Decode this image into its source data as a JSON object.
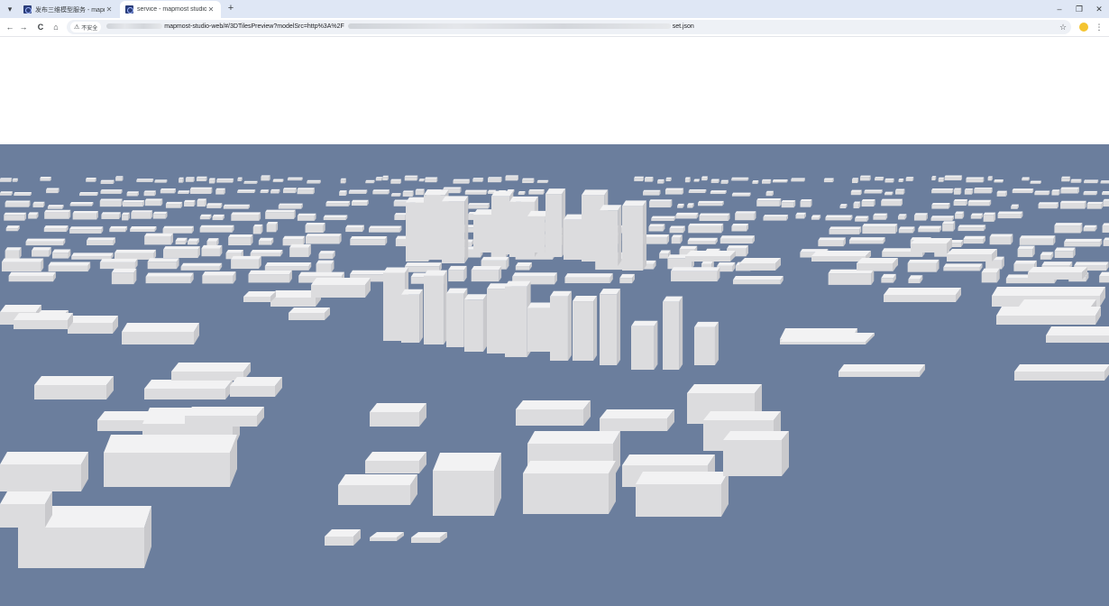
{
  "browser": {
    "tabs": [
      {
        "title": "发布三维模型服务 - mapmost",
        "active": false
      },
      {
        "title": "service - mapmost studio",
        "active": true
      }
    ],
    "new_tab_symbol": "+",
    "window_controls": {
      "minimize": "–",
      "restore": "❐",
      "close": "✕"
    }
  },
  "toolbar": {
    "back": "←",
    "forward": "→",
    "reload": "C",
    "home": "⌂",
    "security_label": "不安全",
    "security_symbol": "⚠",
    "url_visible_middle": "mapmost-studio-web/#/3DTilesPreview?modelSrc=http%3A%2F",
    "url_visible_end": "set.json",
    "bookmark": "☆",
    "menu": "⋮"
  },
  "viewer": {
    "background_color": "#6b7e9d",
    "building_color": "#e8e8ea",
    "content": "3d-tiles-city-buildings"
  }
}
